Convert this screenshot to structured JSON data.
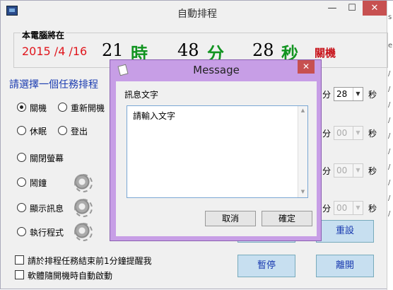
{
  "window": {
    "title": "自動排程",
    "min": "—",
    "max": "☐",
    "close": "✕"
  },
  "clock": {
    "group_title": "本電腦將在",
    "date": "2015 /4 /16",
    "hour": "21",
    "hour_unit": "時",
    "minute": "48",
    "minute_unit": "分",
    "second": "28",
    "second_unit": "秒",
    "action": "關機"
  },
  "tasks": {
    "heading": "請選擇一個任務排程",
    "options": [
      "關機",
      "重新開機",
      "休眠",
      "登出",
      "關閉螢幕",
      "鬧鐘",
      "顯示訊息",
      "執行程式"
    ],
    "selected": "關機"
  },
  "time_rows": [
    {
      "fen": "分",
      "value": "28",
      "miao": "秒",
      "enabled": true
    },
    {
      "fen": "分",
      "value": "00",
      "miao": "秒",
      "enabled": false
    },
    {
      "fen": "分",
      "value": "00",
      "miao": "秒",
      "enabled": false
    },
    {
      "fen": "分",
      "value": "00",
      "miao": "秒",
      "enabled": false
    }
  ],
  "buttons": {
    "reset": "重設",
    "pause": "暫停",
    "leave": "離開"
  },
  "checks": {
    "remind": "請於排程任務結束前1分鐘提醒我",
    "autostart": "軟體隨開機時自動啟動"
  },
  "dialog": {
    "title": "Message",
    "close": "✕",
    "label": "訊息文字",
    "text": "請輸入文字",
    "cancel": "取消",
    "ok": "確定"
  },
  "right_strip": [
    "s",
    "e",
    "/",
    "/",
    "/",
    "/",
    "/",
    "/",
    "/",
    "/",
    "/",
    "/"
  ],
  "colors": {
    "date": "#e0161d",
    "unit": "#119420",
    "heading": "#1a3bb0",
    "dialog_frame": "#c79ee6"
  }
}
